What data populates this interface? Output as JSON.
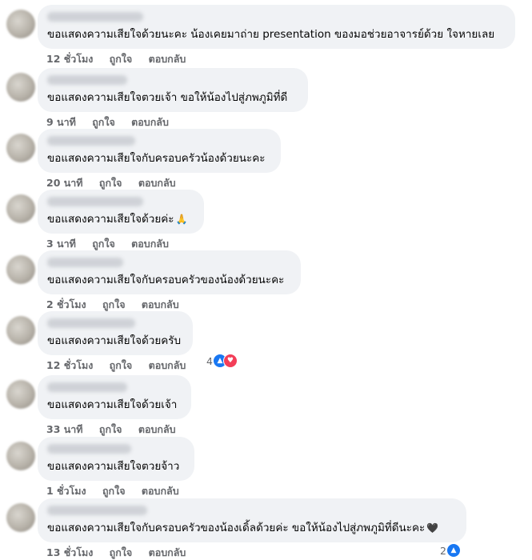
{
  "comments": [
    {
      "text": "ขอแสดงความเสียใจด้วยนะคะ น้องเคยมาถ่าย presentation ของมอช่วยอาจารย์ด้วย ใจหายเลย",
      "time": "12 ชั่วโมง",
      "like": "ถูกใจ",
      "reply": "ตอบกลับ"
    },
    {
      "text": "ขอแสดงความเสียใจตวยเจ้า ขอให้น้องไปสู่ภพภูมิที่ดี",
      "time": "9 นาที",
      "like": "ถูกใจ",
      "reply": "ตอบกลับ"
    },
    {
      "text": "ขอแสดงความเสียใจกับครอบครัวน้องด้วยนะคะ",
      "time": "20 นาที",
      "like": "ถูกใจ",
      "reply": "ตอบกลับ"
    },
    {
      "text": "ขอแสดงความเสียใจด้วยค่ะ",
      "emoji": "🙏",
      "time": "3 นาที",
      "like": "ถูกใจ",
      "reply": "ตอบกลับ"
    },
    {
      "text": "ขอแสดงความเสียใจกับครอบครัวของน้องด้วยนะคะ",
      "time": "2 ชั่วโมง",
      "like": "ถูกใจ",
      "reply": "ตอบกลับ"
    },
    {
      "text": "ขอแสดงความเสียใจด้วยครับ",
      "time": "12 ชั่วโมง",
      "like": "ถูกใจ",
      "reply": "ตอบกลับ",
      "reaction_count": "4"
    },
    {
      "text": "ขอแสดงความเสียใจด้วยเจ้า",
      "time": "33 นาที",
      "like": "ถูกใจ",
      "reply": "ตอบกลับ"
    },
    {
      "text": "ขอแสดงความเสียใจตวยจ้าว",
      "time": "1 ชั่วโมง",
      "like": "ถูกใจ",
      "reply": "ตอบกลับ"
    },
    {
      "text": "ขอแสดงความเสียใจกับครอบครัวของน้องเดิ้ลด้วยค่ะ ขอให้น้องไปสู่ภพภูมิที่ดีนะคะ",
      "emoji": "🖤",
      "time": "13 ชั่วโมง",
      "like": "ถูกใจ",
      "reply": "ตอบกลับ",
      "reaction_count": "2"
    }
  ],
  "icons": {
    "like": "thumbs-up-icon",
    "love": "heart-icon"
  },
  "colors": {
    "bubble": "#f0f2f5",
    "meta_text": "#65676b",
    "like_blue": "#1877f2",
    "love_red": "#f33e58"
  }
}
